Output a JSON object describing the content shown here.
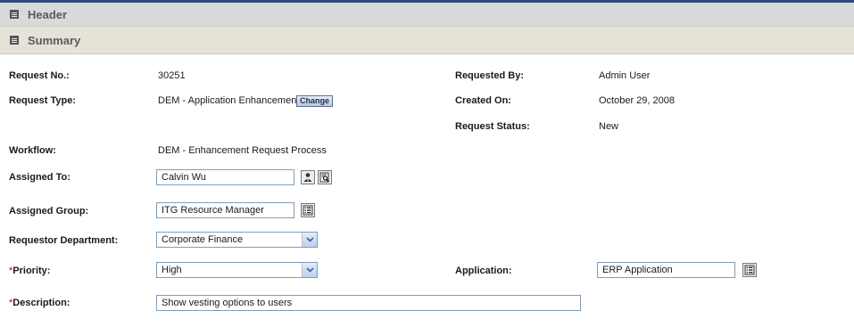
{
  "sections": {
    "header": {
      "title": "Header"
    },
    "summary": {
      "title": "Summary"
    }
  },
  "fields": {
    "request_no": {
      "label": "Request No.:",
      "value": "30251"
    },
    "request_type": {
      "label": "Request Type:",
      "value": "DEM - Application Enhancement",
      "change_label": "Change"
    },
    "workflow": {
      "label": "Workflow:",
      "value": "DEM - Enhancement Request Process"
    },
    "assigned_to": {
      "label": "Assigned To:",
      "value": "Calvin Wu"
    },
    "assigned_group": {
      "label": "Assigned Group:",
      "value": "ITG Resource Manager"
    },
    "requestor_department": {
      "label": "Requestor Department:",
      "value": "Corporate Finance"
    },
    "priority": {
      "required_mark": "*",
      "label": "Priority:",
      "value": "High"
    },
    "description": {
      "required_mark": "*",
      "label": "Description:",
      "value": "Show vesting options to users"
    },
    "requested_by": {
      "label": "Requested By:",
      "value": "Admin User"
    },
    "created_on": {
      "label": "Created On:",
      "value": "October 29, 2008"
    },
    "request_status": {
      "label": "Request Status:",
      "value": "New"
    },
    "application": {
      "label": "Application:",
      "value": "ERP Application"
    }
  },
  "icons": {
    "collapse": "collapse-icon",
    "user_lookup": "user-lookup-icon",
    "search_lookup": "search-lookup-icon",
    "list_lookup": "list-lookup-icon",
    "dropdown": "chevron-down-icon"
  },
  "colors": {
    "top_border": "#2b4f7a",
    "header_bar": "#d9d9d9",
    "summary_bar": "#e7e2d8",
    "required": "#cc0000",
    "input_border": "#7f9db9"
  }
}
